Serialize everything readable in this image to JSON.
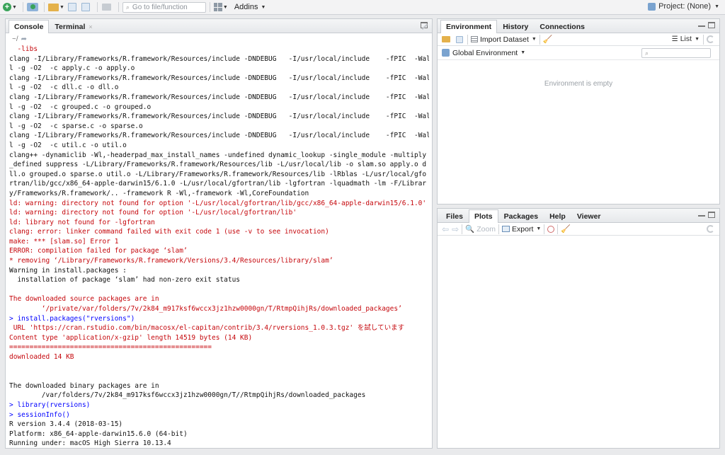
{
  "toolbar": {
    "goto_placeholder": "Go to file/function",
    "addins_label": "Addins",
    "project_label": "Project: (None)"
  },
  "console": {
    "tabs": [
      {
        "label": "Console"
      },
      {
        "label": "Terminal",
        "close": "×"
      }
    ],
    "path": "~/",
    "lines": [
      {
        "text": "  -libs",
        "type": "err"
      },
      {
        "text": "clang -I/Library/Frameworks/R.framework/Resources/include -DNDEBUG   -I/usr/local/include    -fPIC  -Wal",
        "type": "out"
      },
      {
        "text": "l -g -O2  -c apply.c -o apply.o",
        "type": "out"
      },
      {
        "text": "clang -I/Library/Frameworks/R.framework/Resources/include -DNDEBUG   -I/usr/local/include    -fPIC  -Wal",
        "type": "out"
      },
      {
        "text": "l -g -O2  -c dll.c -o dll.o",
        "type": "out"
      },
      {
        "text": "clang -I/Library/Frameworks/R.framework/Resources/include -DNDEBUG   -I/usr/local/include    -fPIC  -Wal",
        "type": "out"
      },
      {
        "text": "l -g -O2  -c grouped.c -o grouped.o",
        "type": "out"
      },
      {
        "text": "clang -I/Library/Frameworks/R.framework/Resources/include -DNDEBUG   -I/usr/local/include    -fPIC  -Wal",
        "type": "out"
      },
      {
        "text": "l -g -O2  -c sparse.c -o sparse.o",
        "type": "out"
      },
      {
        "text": "clang -I/Library/Frameworks/R.framework/Resources/include -DNDEBUG   -I/usr/local/include    -fPIC  -Wal",
        "type": "out"
      },
      {
        "text": "l -g -O2  -c util.c -o util.o",
        "type": "out"
      },
      {
        "text": "clang++ -dynamiclib -Wl,-headerpad_max_install_names -undefined dynamic_lookup -single_module -multiply",
        "type": "out"
      },
      {
        "text": "_defined suppress -L/Library/Frameworks/R.framework/Resources/lib -L/usr/local/lib -o slam.so apply.o d",
        "type": "out"
      },
      {
        "text": "ll.o grouped.o sparse.o util.o -L/Library/Frameworks/R.framework/Resources/lib -lRblas -L/usr/local/gfo",
        "type": "out"
      },
      {
        "text": "rtran/lib/gcc/x86_64-apple-darwin15/6.1.0 -L/usr/local/gfortran/lib -lgfortran -lquadmath -lm -F/Librar",
        "type": "out"
      },
      {
        "text": "y/Frameworks/R.framework/.. -framework R -Wl,-framework -Wl,CoreFoundation",
        "type": "out"
      },
      {
        "text": "ld: warning: directory not found for option '-L/usr/local/gfortran/lib/gcc/x86_64-apple-darwin15/6.1.0'",
        "type": "err"
      },
      {
        "text": "ld: warning: directory not found for option '-L/usr/local/gfortran/lib'",
        "type": "err"
      },
      {
        "text": "ld: library not found for -lgfortran",
        "type": "err"
      },
      {
        "text": "clang: error: linker command failed with exit code 1 (use -v to see invocation)",
        "type": "err"
      },
      {
        "text": "make: *** [slam.so] Error 1",
        "type": "err"
      },
      {
        "text": "ERROR: compilation failed for package ‘slam’",
        "type": "err"
      },
      {
        "text": "* removing ‘/Library/Frameworks/R.framework/Versions/3.4/Resources/library/slam’",
        "type": "err"
      },
      {
        "text": "Warning in install.packages :",
        "type": "out"
      },
      {
        "text": "  installation of package ‘slam’ had non-zero exit status",
        "type": "out"
      },
      {
        "text": "",
        "type": "out"
      },
      {
        "text": "The downloaded source packages are in",
        "type": "err"
      },
      {
        "text": "        ‘/private/var/folders/7v/2k84_m917ksf6wccx3jz1hzw0000gn/T/RtmpQihjRs/downloaded_packages’",
        "type": "err"
      },
      {
        "text": "> install.packages(\"rversions\")",
        "type": "cmd"
      },
      {
        "text": " URL 'https://cran.rstudio.com/bin/macosx/el-capitan/contrib/3.4/rversions_1.0.3.tgz' を試しています",
        "type": "err"
      },
      {
        "text": "Content type 'application/x-gzip' length 14519 bytes (14 KB)",
        "type": "err"
      },
      {
        "text": "==================================================",
        "type": "err"
      },
      {
        "text": "downloaded 14 KB",
        "type": "err"
      },
      {
        "text": "",
        "type": "out"
      },
      {
        "text": "",
        "type": "out"
      },
      {
        "text": "The downloaded binary packages are in",
        "type": "out"
      },
      {
        "text": "        /var/folders/7v/2k84_m917ksf6wccx3jz1hzw0000gn/T//RtmpQihjRs/downloaded_packages",
        "type": "out"
      },
      {
        "text": "> library(rversions)",
        "type": "cmd"
      },
      {
        "text": "> sessionInfo()",
        "type": "cmd"
      },
      {
        "text": "R version 3.4.4 (2018-03-15)",
        "type": "out"
      },
      {
        "text": "Platform: x86_64-apple-darwin15.6.0 (64-bit)",
        "type": "out"
      },
      {
        "text": "Running under: macOS High Sierra 10.13.4",
        "type": "out"
      }
    ]
  },
  "environment": {
    "tabs": [
      {
        "label": "Environment"
      },
      {
        "label": "History"
      },
      {
        "label": "Connections"
      }
    ],
    "import_label": "Import Dataset",
    "list_label": "List",
    "scope_label": "Global Environment",
    "empty_text": "Environment is empty"
  },
  "files": {
    "tabs": [
      {
        "label": "Files"
      },
      {
        "label": "Plots"
      },
      {
        "label": "Packages"
      },
      {
        "label": "Help"
      },
      {
        "label": "Viewer"
      }
    ],
    "zoom_label": "Zoom",
    "export_label": "Export"
  },
  "colors": {
    "error_text": "#c5060b",
    "command_text": "#0000ff"
  }
}
